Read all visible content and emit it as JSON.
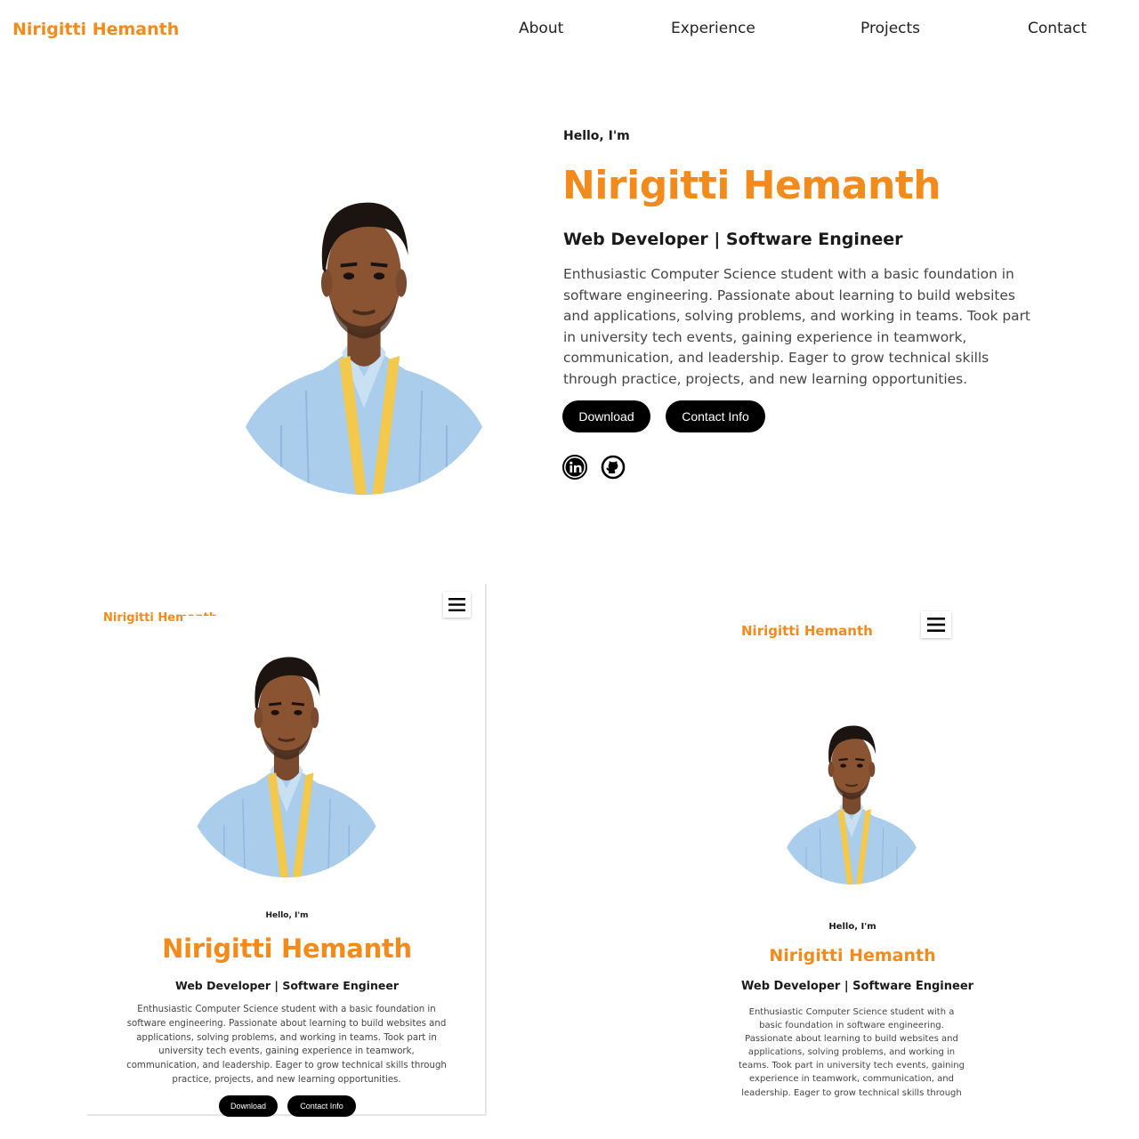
{
  "header": {
    "brand": "Nirigitti Hemanth",
    "nav": [
      "About",
      "Experience",
      "Projects",
      "Contact"
    ]
  },
  "hero": {
    "greeting": "Hello, I'm",
    "name": "Nirigitti Hemanth",
    "role": "Web Developer | Software Engineer",
    "description": "Enthusiastic Computer Science student with a basic foundation in software engineering. Passionate about learning to build websites and applications, solving problems, and working in teams. Took part in university tech events, gaining experience in teamwork, communication, and leadership. Eager to grow technical skills through practice, projects, and new learning opportunities.",
    "buttons": {
      "download": "Download",
      "contact": "Contact Info"
    },
    "social_icons": [
      "linkedin-icon",
      "github-icon"
    ]
  },
  "tablet": {
    "brand": "Nirigitti Hemanth",
    "greeting": "Hello, I'm",
    "name": "Nirigitti Hemanth",
    "role": "Web Developer | Software Engineer",
    "description": "Enthusiastic Computer Science student with a basic foundation in software engineering. Passionate about learning to build websites and applications, solving problems, and working in teams. Took part in university tech events, gaining experience in teamwork, communication, and leadership. Eager to grow technical skills through practice, projects, and new learning opportunities.",
    "buttons": {
      "download": "Download",
      "contact": "Contact Info"
    },
    "menu_icon": "hamburger-menu-icon"
  },
  "mobile": {
    "brand": "Nirigitti Hemanth",
    "greeting": "Hello, I'm",
    "name": "Nirigitti Hemanth",
    "role": "Web Developer | Software Engineer",
    "description": "Enthusiastic Computer Science student with a basic foundation in software engineering. Passionate about learning to build websites and applications, solving problems, and working in teams. Took part in university tech events, gaining experience in teamwork, communication, and leadership. Eager to grow technical skills through",
    "menu_icon": "hamburger-menu-icon"
  },
  "colors": {
    "accent": "#f28a1c",
    "button_bg": "#000000",
    "text": "#1a1a1a",
    "shirt": "#a9cdea",
    "lanyard": "#f2c94c"
  }
}
